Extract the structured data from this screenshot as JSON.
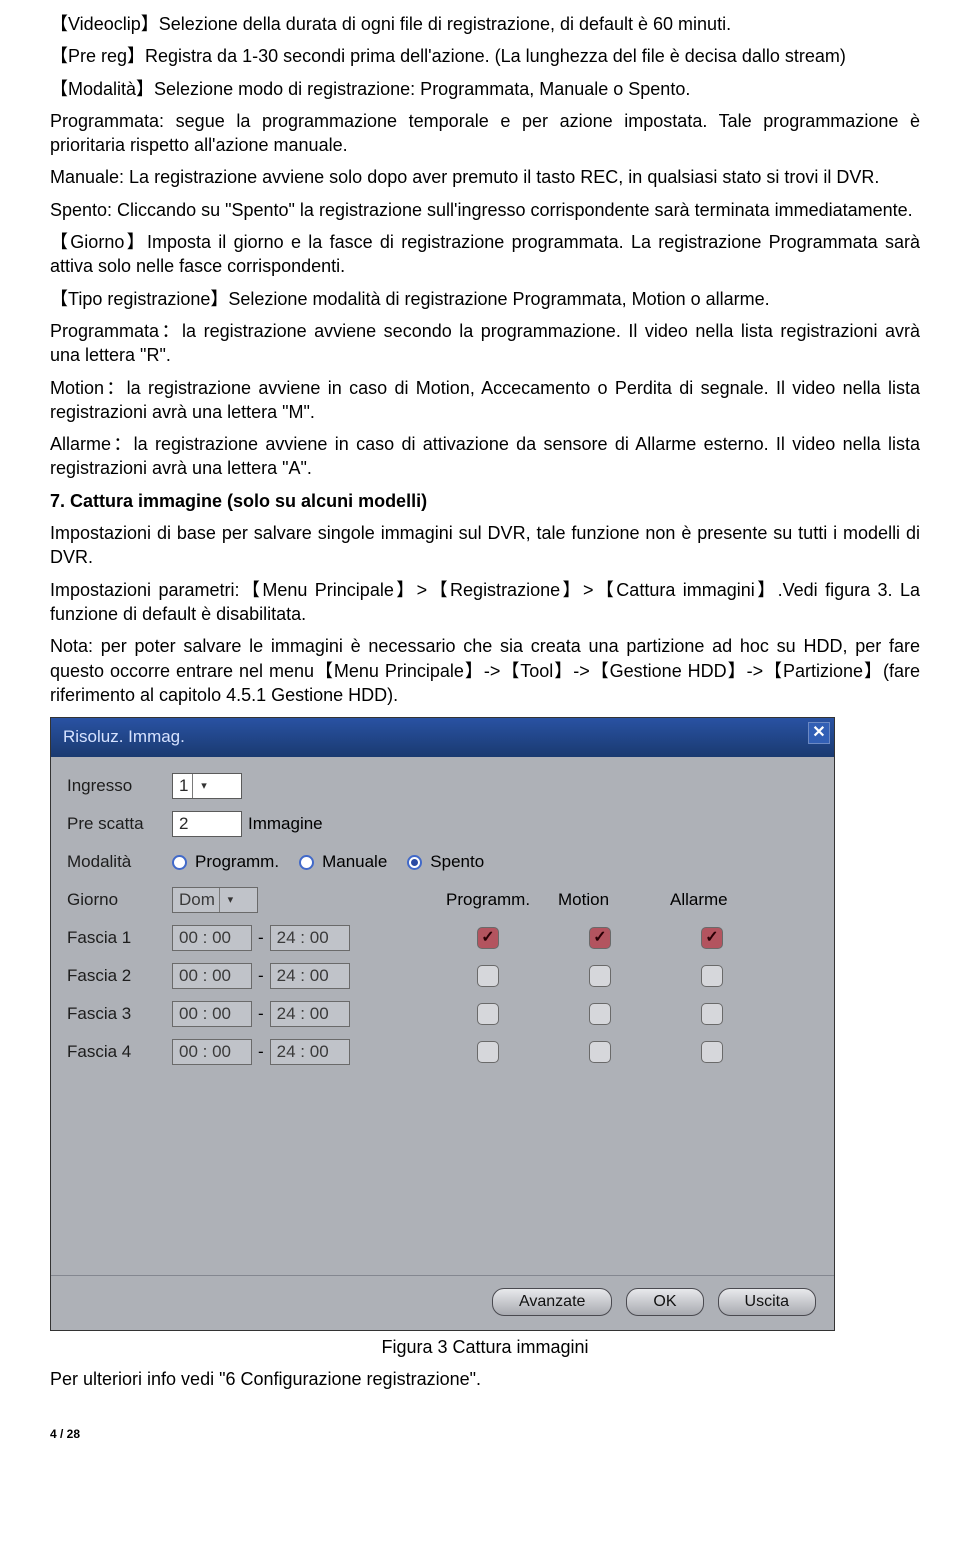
{
  "paragraphs": {
    "videoclip": "【Videoclip】Selezione della durata di ogni file di registrazione, di default è 60 minuti.",
    "prereg": "【Pre reg】Registra da 1-30 secondi prima dell'azione. (La lunghezza del file è decisa dallo stream)",
    "modalita": "【Modalità】Selezione modo di registrazione: Programmata, Manuale o Spento.",
    "programmata1": "Programmata: segue la programmazione temporale e per azione impostata. Tale programmazione è prioritaria rispetto all'azione manuale.",
    "manuale": "Manuale: La registrazione avviene solo dopo aver premuto il tasto REC, in qualsiasi stato si trovi il DVR.",
    "spento": "Spento: Cliccando su \"Spento\" la registrazione sull'ingresso corrispondente sarà terminata immediatamente.",
    "giorno": "【Giorno】Imposta il giorno e la fasce di registrazione programmata. La registrazione Programmata sarà attiva solo nelle fasce corrispondenti.",
    "tiporeg": "【Tipo registrazione】Selezione modalità di registrazione Programmata, Motion o allarme.",
    "programmata2": "Programmata：la registrazione avviene secondo la programmazione. Il video nella lista registrazioni avrà una lettera \"R\".",
    "motion": "Motion：la registrazione avviene in caso di Motion, Accecamento o Perdita di segnale. Il video nella lista registrazioni avrà una lettera \"M\".",
    "allarme": "Allarme：la registrazione avviene in caso di attivazione da sensore di Allarme esterno. Il video nella lista registrazioni avrà una lettera \"A\".",
    "h7": "7. Cattura immagine (solo su alcuni modelli)",
    "base": "Impostazioni di base per salvare singole immagini sul DVR, tale funzione non è presente su tutti i modelli di DVR.",
    "params": "Impostazioni parametri:【Menu Principale】>【Registrazione】>【Cattura immagini】.Vedi figura 3. La funzione di default è disabilitata.",
    "nota": "Nota: per poter salvare le immagini è necessario che sia creata una partizione ad hoc su HDD, per fare questo occorre entrare nel menu【Menu Principale】->【Tool】->【Gestione HDD】->【Partizione】(fare riferimento al capitolo 4.5.1 Gestione HDD).",
    "caption": "Figura 3 Cattura immagini",
    "after": "Per ulteriori info vedi \"6 Configurazione registrazione\".",
    "pagenum": "4 / 28"
  },
  "dialog": {
    "title": "Risoluz. Immag.",
    "labels": {
      "ingresso": "Ingresso",
      "prescatta": "Pre scatta",
      "immagine": "Immagine",
      "modalita": "Modalità",
      "giorno": "Giorno",
      "programm_hdr": "Programm.",
      "motion_hdr": "Motion",
      "allarme_hdr": "Allarme",
      "fascia1": "Fascia 1",
      "fascia2": "Fascia 2",
      "fascia3": "Fascia 3",
      "fascia4": "Fascia 4"
    },
    "values": {
      "ingresso": "1",
      "prescatta": "2",
      "giorno": "Dom",
      "time_start": "00 : 00",
      "time_sep": "-",
      "time_end": "24 : 00"
    },
    "radios": {
      "programm": "Programm.",
      "manuale": "Manuale",
      "spento": "Spento"
    },
    "buttons": {
      "avanzate": "Avanzate",
      "ok": "OK",
      "uscita": "Uscita"
    }
  }
}
